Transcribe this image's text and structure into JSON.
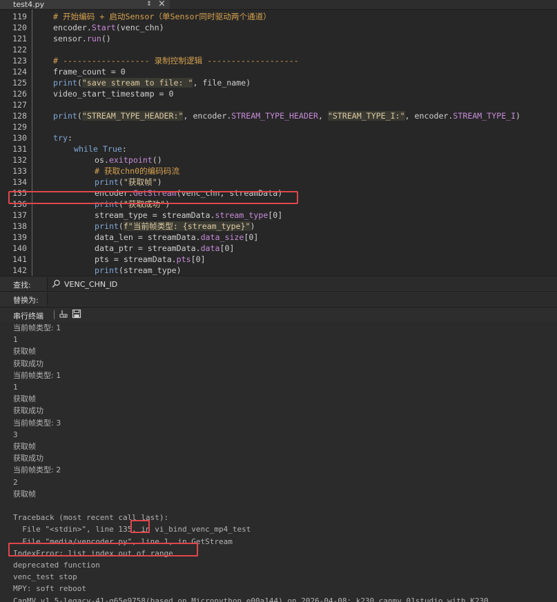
{
  "tab": {
    "title": "test4.py",
    "arrows_icon": "⇕",
    "close_icon": "×"
  },
  "editor": {
    "lines": [
      {
        "n": "119",
        "indent": 0,
        "tokens": [
          {
            "t": "cm",
            "v": "# 开始编码 + 启动Sensor（单Sensor同时驱动两个通道）"
          }
        ]
      },
      {
        "n": "120",
        "indent": 0,
        "tokens": [
          {
            "t": "p",
            "v": "encoder."
          },
          {
            "t": "fn",
            "v": "Start"
          },
          {
            "t": "p",
            "v": "(venc_chn)"
          }
        ]
      },
      {
        "n": "121",
        "indent": 0,
        "tokens": [
          {
            "t": "p",
            "v": "sensor."
          },
          {
            "t": "fn",
            "v": "run"
          },
          {
            "t": "p",
            "v": "()"
          }
        ]
      },
      {
        "n": "122",
        "indent": 0,
        "tokens": []
      },
      {
        "n": "123",
        "indent": 0,
        "tokens": [
          {
            "t": "cm",
            "v": "# ------------------ 录制控制逻辑 -------------------"
          }
        ]
      },
      {
        "n": "124",
        "indent": 0,
        "tokens": [
          {
            "t": "p",
            "v": "frame_count = 0"
          }
        ]
      },
      {
        "n": "125",
        "indent": 0,
        "tokens": [
          {
            "t": "kw",
            "v": "print"
          },
          {
            "t": "p",
            "v": "("
          },
          {
            "t": "str",
            "v": "\"save stream to file: \""
          },
          {
            "t": "p",
            "v": ", file_name)"
          }
        ]
      },
      {
        "n": "126",
        "indent": 0,
        "tokens": [
          {
            "t": "p",
            "v": "video_start_timestamp = 0"
          }
        ]
      },
      {
        "n": "127",
        "indent": 0,
        "tokens": []
      },
      {
        "n": "128",
        "indent": 0,
        "tokens": [
          {
            "t": "kw",
            "v": "print"
          },
          {
            "t": "p",
            "v": "("
          },
          {
            "t": "str",
            "v": "\"STREAM_TYPE_HEADER:\""
          },
          {
            "t": "p",
            "v": ", encoder."
          },
          {
            "t": "fn",
            "v": "STREAM_TYPE_HEADER"
          },
          {
            "t": "p",
            "v": ", "
          },
          {
            "t": "str",
            "v": "\"STREAM_TYPE_I:\""
          },
          {
            "t": "p",
            "v": ", encoder."
          },
          {
            "t": "fn",
            "v": "STREAM_TYPE_I"
          },
          {
            "t": "p",
            "v": ")"
          }
        ]
      },
      {
        "n": "129",
        "indent": 0,
        "tokens": []
      },
      {
        "n": "130",
        "indent": 0,
        "tokens": [
          {
            "t": "kw",
            "v": "try"
          },
          {
            "t": "p",
            "v": ":"
          }
        ]
      },
      {
        "n": "131",
        "indent": 1,
        "tokens": [
          {
            "t": "kw",
            "v": "while"
          },
          {
            "t": "p",
            "v": " "
          },
          {
            "t": "kw",
            "v": "True"
          },
          {
            "t": "p",
            "v": ":"
          }
        ]
      },
      {
        "n": "132",
        "indent": 2,
        "tokens": [
          {
            "t": "p",
            "v": "os."
          },
          {
            "t": "fn",
            "v": "exitpoint"
          },
          {
            "t": "p",
            "v": "()"
          }
        ]
      },
      {
        "n": "133",
        "indent": 2,
        "tokens": [
          {
            "t": "cm",
            "v": "# 获取chn0的编码码流"
          }
        ]
      },
      {
        "n": "134",
        "indent": 2,
        "tokens": [
          {
            "t": "kw",
            "v": "print"
          },
          {
            "t": "p",
            "v": "("
          },
          {
            "t": "strp",
            "v": "\"获取帧\""
          },
          {
            "t": "p",
            "v": ")"
          }
        ]
      },
      {
        "n": "135",
        "indent": 2,
        "tokens": [
          {
            "t": "p",
            "v": "encoder."
          },
          {
            "t": "fn",
            "v": "GetStream"
          },
          {
            "t": "p",
            "v": "(venc_chn, streamData)"
          }
        ]
      },
      {
        "n": "136",
        "indent": 2,
        "tokens": [
          {
            "t": "kw",
            "v": "print"
          },
          {
            "t": "p",
            "v": "("
          },
          {
            "t": "strp",
            "v": "\"获取成功\""
          },
          {
            "t": "p",
            "v": ")"
          }
        ]
      },
      {
        "n": "137",
        "indent": 2,
        "tokens": [
          {
            "t": "p",
            "v": "stream_type = streamData."
          },
          {
            "t": "fn",
            "v": "stream_type"
          },
          {
            "t": "p",
            "v": "[0]"
          }
        ]
      },
      {
        "n": "138",
        "indent": 2,
        "tokens": [
          {
            "t": "kw",
            "v": "print"
          },
          {
            "t": "p",
            "v": "("
          },
          {
            "t": "str",
            "v": "f\"当前帧类型: {stream_type}\""
          },
          {
            "t": "p",
            "v": ")"
          }
        ]
      },
      {
        "n": "139",
        "indent": 2,
        "tokens": [
          {
            "t": "p",
            "v": "data_len = streamData."
          },
          {
            "t": "fn",
            "v": "data_size"
          },
          {
            "t": "p",
            "v": "[0]"
          }
        ]
      },
      {
        "n": "140",
        "indent": 2,
        "tokens": [
          {
            "t": "p",
            "v": "data_ptr = streamData."
          },
          {
            "t": "fn",
            "v": "data"
          },
          {
            "t": "p",
            "v": "[0]"
          }
        ]
      },
      {
        "n": "141",
        "indent": 2,
        "tokens": [
          {
            "t": "p",
            "v": "pts = streamData."
          },
          {
            "t": "fn",
            "v": "pts"
          },
          {
            "t": "p",
            "v": "[0]"
          }
        ]
      },
      {
        "n": "142",
        "indent": 2,
        "tokens": [
          {
            "t": "kw",
            "v": "print"
          },
          {
            "t": "p",
            "v": "(stream_type)"
          }
        ]
      }
    ]
  },
  "find": {
    "label": "查找:",
    "icon": "search-icon",
    "value": "VENC_CHN_ID"
  },
  "replace": {
    "label": "替换为:"
  },
  "serial": {
    "title": "串行终端",
    "clear_glyph": "⌫",
    "save_glyph": "▣"
  },
  "console": {
    "lines": [
      "当前帧类型: 1",
      "1",
      "获取帧",
      "获取成功",
      "当前帧类型: 1",
      "1",
      "获取帧",
      "获取成功",
      "当前帧类型: 3",
      "3",
      "获取帧",
      "获取成功",
      "当前帧类型: 2",
      "2",
      "获取帧",
      "",
      "Traceback (most recent call last):",
      "  File \"<stdin>\", line 135, in vi_bind_venc_mp4_test",
      "  File \"media/vencoder.py\", line 1, in GetStream",
      "IndexError: list index out of range",
      "deprecated function",
      "venc_test stop",
      "MPY: soft reboot",
      "CanMV v1.5-legacy-41-g65e9758(based on Micropython e00a144) on 2026-04-08; k230_canmv_01studio with K230"
    ]
  },
  "colors": {
    "highlight_box": "#e0474c",
    "comment": "#d4a14f",
    "keyword": "#7fa8d6",
    "function": "#c68bd8",
    "string": "#dcc9a0"
  }
}
